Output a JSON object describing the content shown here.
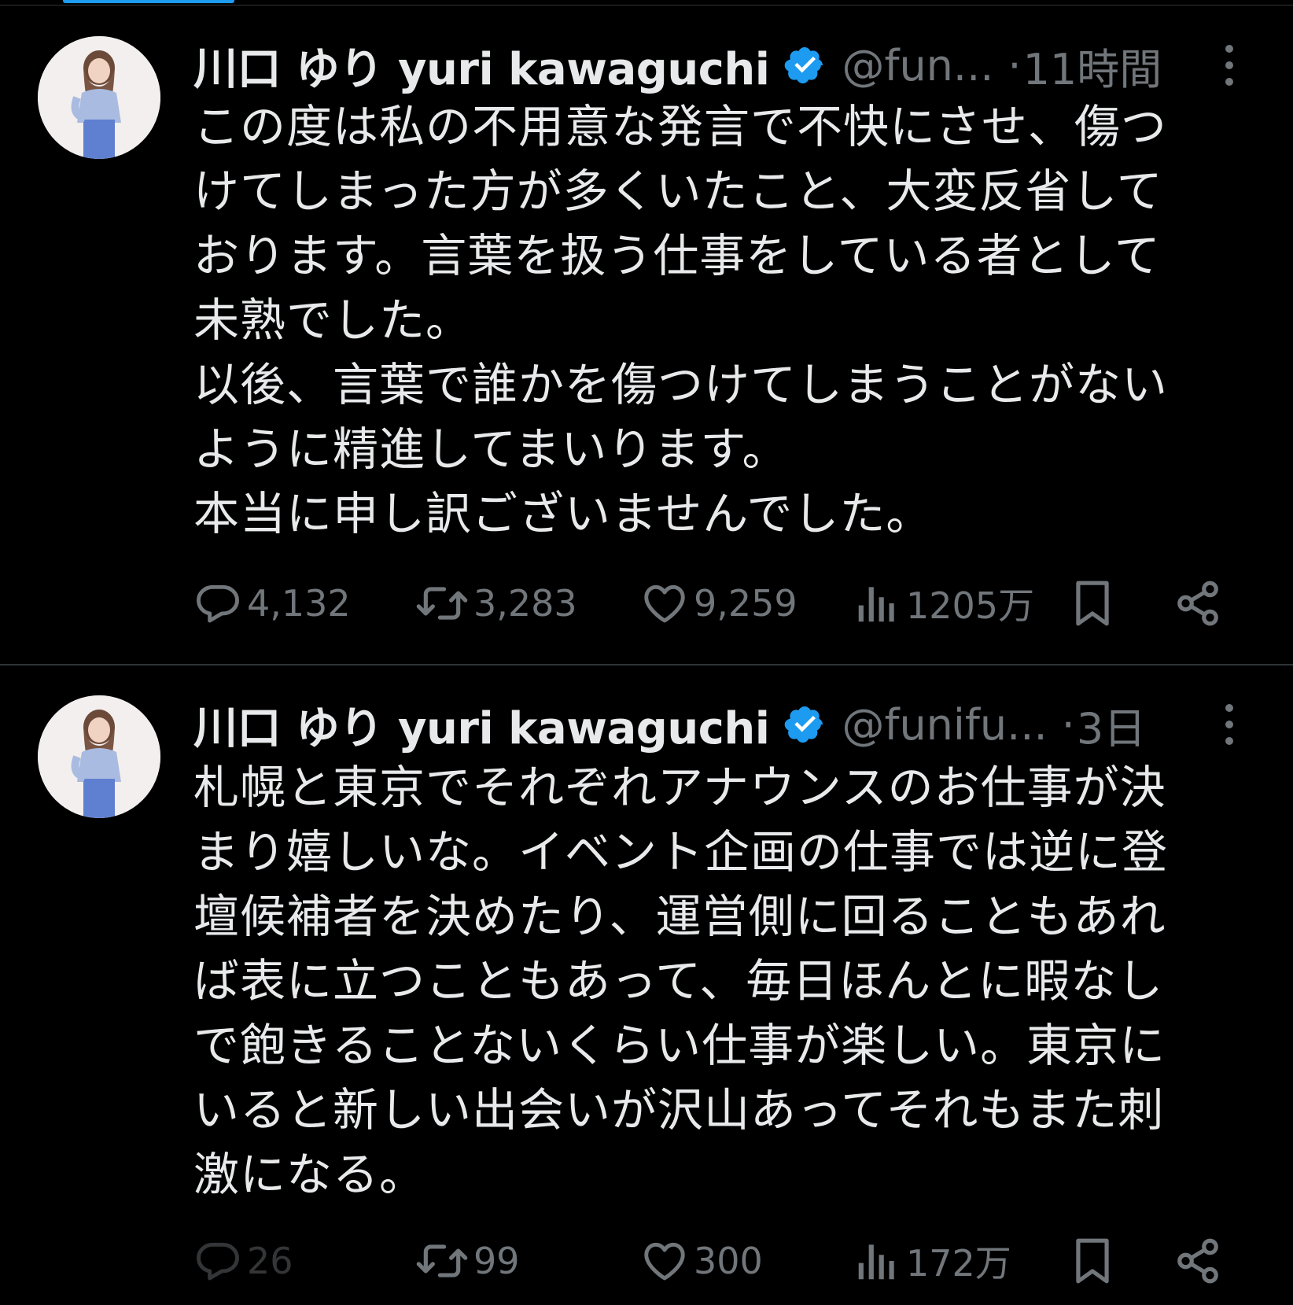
{
  "tweets": [
    {
      "author": {
        "display_name": "川口 ゆり yuri kawaguchi",
        "handle": "@fun...",
        "verified": true
      },
      "time": "11時間",
      "dot": "·",
      "body_lines": [
        "この度は私の不用意な発言で不快にさせ、傷つ",
        "けてしまった方が多くいたこと、大変反省して",
        "おります。言葉を扱う仕事をしている者として",
        "未熟でした。",
        "以後、言葉で誰かを傷つけてしまうことがない",
        "ように精進してまいります。",
        "本当に申し訳ございませんでした。"
      ],
      "stats": {
        "replies": "4,132",
        "retweets": "3,283",
        "likes": "9,259",
        "views": "1205万"
      }
    },
    {
      "author": {
        "display_name": "川口 ゆり yuri kawaguchi",
        "handle": "@funifu...",
        "verified": true
      },
      "time": "3日",
      "dot": "·",
      "body_lines": [
        "札幌と東京でそれぞれアナウンスのお仕事が決",
        "まり嬉しいな。イベント企画の仕事では逆に登",
        "壇候補者を決めたり、運営側に回ることもあれ",
        "ば表に立つこともあって、毎日ほんとに暇なし",
        "で飽きることないくらい仕事が楽しい。東京に",
        "いると新しい出会いが沢山あってそれもまた刺",
        "激になる。"
      ],
      "stats": {
        "replies": "26",
        "retweets": "99",
        "likes": "300",
        "views": "172万"
      }
    }
  ],
  "icons": {
    "verified": "verified-badge-icon",
    "more": "more-vertical-icon",
    "reply": "reply-icon",
    "retweet": "retweet-icon",
    "like": "heart-icon",
    "views": "views-chart-icon",
    "bookmark": "bookmark-icon",
    "share": "share-icon"
  },
  "colors": {
    "background": "#000000",
    "text_primary": "#e7e9ea",
    "text_secondary": "#71767b",
    "verified_blue": "#1d9bf0",
    "divider": "#2f3336"
  }
}
